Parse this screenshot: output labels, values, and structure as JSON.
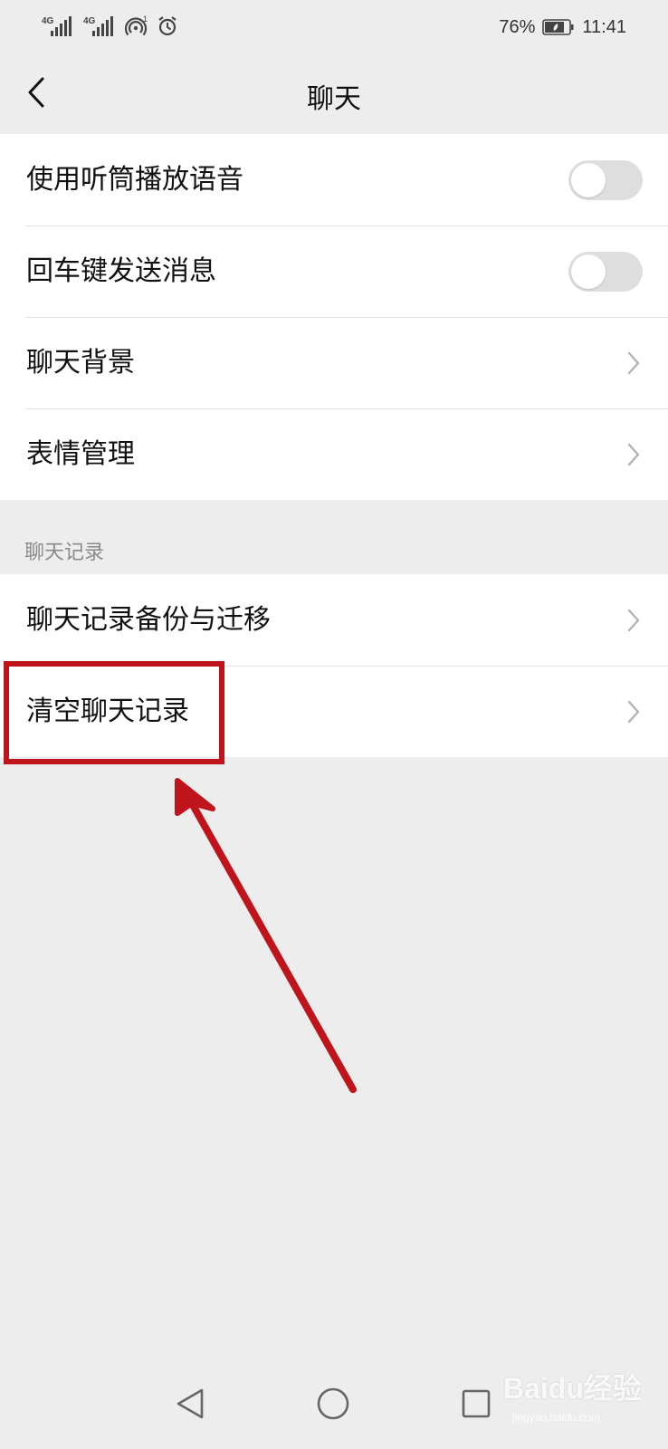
{
  "status_bar": {
    "signal1_label": "4G",
    "signal2_label": "4G",
    "hotspot_count": "1",
    "battery_percent": "76%",
    "time": "11:41"
  },
  "header": {
    "title": "聊天"
  },
  "settings": {
    "group1": [
      {
        "label": "使用听筒播放语音",
        "control": "toggle",
        "on": false
      },
      {
        "label": "回车键发送消息",
        "control": "toggle",
        "on": false
      },
      {
        "label": "聊天背景",
        "control": "chevron"
      },
      {
        "label": "表情管理",
        "control": "chevron"
      }
    ],
    "section_title": "聊天记录",
    "group2": [
      {
        "label": "聊天记录备份与迁移",
        "control": "chevron"
      },
      {
        "label": "清空聊天记录",
        "control": "chevron"
      }
    ]
  },
  "annotation": {
    "color": "#c0141c",
    "highlighted_item": "清空聊天记录"
  },
  "nav_bar": {
    "icons": [
      "back-triangle-icon",
      "home-circle-icon",
      "recent-square-icon"
    ]
  },
  "watermark": {
    "brand": "Baidu经验",
    "url": "jingyan.baidu.com"
  },
  "colors": {
    "background": "#ededed",
    "card": "#ffffff",
    "toggle_off": "#dedede",
    "section_text": "#8a8a8a"
  }
}
